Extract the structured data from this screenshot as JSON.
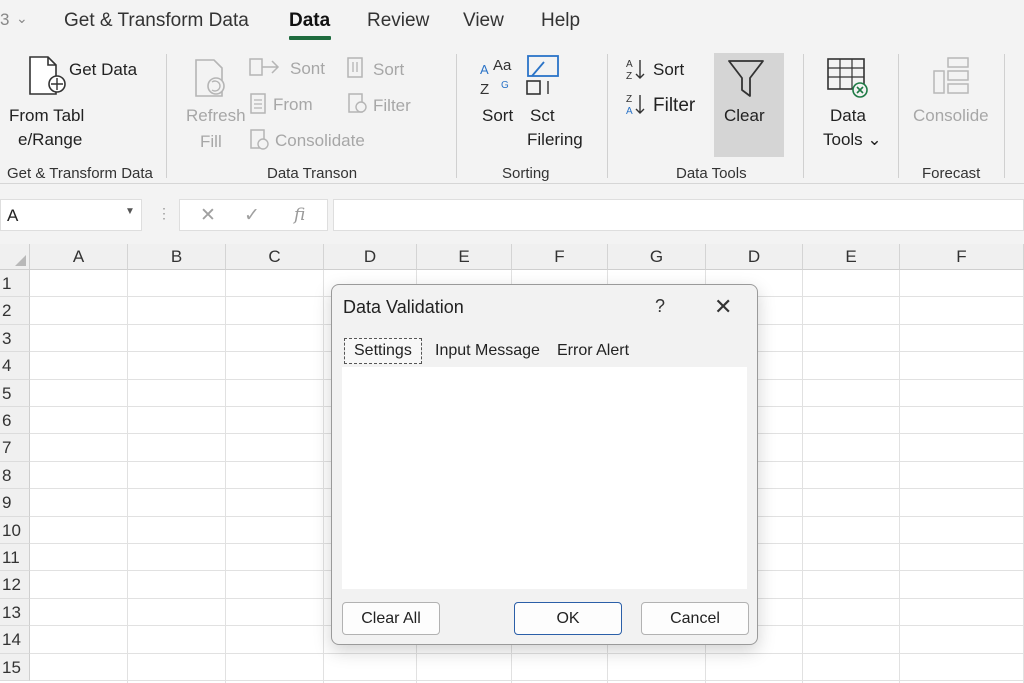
{
  "qat": {
    "number": "3",
    "chevron": "⌄"
  },
  "tabs": [
    {
      "label": "Get & Transform Data"
    },
    {
      "label": "Data",
      "active": true
    },
    {
      "label": "Review"
    },
    {
      "label": "View"
    },
    {
      "label": "Help"
    }
  ],
  "ribbon": {
    "get_transform": {
      "get_data": "Get Data",
      "from_table_1": "From Tabl",
      "from_table_2": "e/Range",
      "group_label": "Get & Transform Data"
    },
    "data_transform": {
      "refresh": "Refresh",
      "fill": "Fill",
      "sont": "Sont",
      "from": "From",
      "consolidate": "Consolidate",
      "sort": "Sort",
      "filter": "Filter",
      "group_label": "Data Transon"
    },
    "sorting": {
      "sort_label": "Sort",
      "sct_label_1": "Sct",
      "sct_label_2": "Filering",
      "az_icon_top": "Aa",
      "group_label": "Sorting"
    },
    "data_tools": {
      "sort": "Sort",
      "filter": "Filter",
      "clear": "Clear",
      "data_tools_1": "Data",
      "data_tools_2": "Tools ⌄",
      "group_label": "Data Tools"
    },
    "forecast": {
      "consolide": "Consolide",
      "group_label": "Forecast"
    }
  },
  "formula_bar": {
    "name_box": "A",
    "x_symbol": "✕",
    "check_symbol": "✓",
    "fx_symbol": "fi",
    "formula": ""
  },
  "grid": {
    "columns": [
      "A",
      "B",
      "C",
      "D",
      "E",
      "F",
      "G",
      "D",
      "E",
      "F"
    ],
    "rows": [
      "1",
      "2",
      "3",
      "4",
      "5",
      "6",
      "7",
      "8",
      "9",
      "10",
      "11",
      "12",
      "13",
      "14",
      "15"
    ]
  },
  "dialog": {
    "title": "Data Validation",
    "help": "?",
    "close": "✕",
    "tabs": [
      "Settings",
      "Input Message",
      "Error Alert"
    ],
    "buttons": {
      "clear_all": "Clear All",
      "ok": "OK",
      "cancel": "Cancel"
    }
  }
}
